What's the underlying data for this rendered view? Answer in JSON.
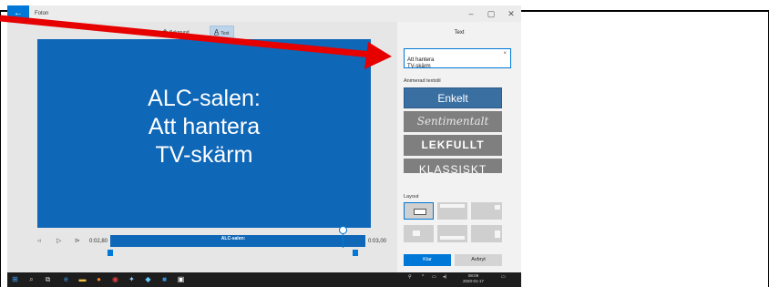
{
  "app": {
    "title": "Foton",
    "back_glyph": "←"
  },
  "window_controls": {
    "minimize": "–",
    "maximize": "▢",
    "close": "✕"
  },
  "toolbar": {
    "background_label": "Bakgrund",
    "text_label": "Text"
  },
  "preview": {
    "title_text": "ALC-salen:\nAtt hantera\nTV-skärm",
    "bg_color": "#0f67b8"
  },
  "playback": {
    "start_time": "0:02,80",
    "end_time": "0:03,00",
    "clip_label": "ALC-salen:"
  },
  "panel": {
    "heading": "Text",
    "input_value": "Att hantera\nTV-skärm",
    "clear_glyph": "×",
    "animated_style_label": "Animerad textstil",
    "styles": [
      "Enkelt",
      "Sentimentalt",
      "LEKFULLT",
      "KLASSISKT"
    ],
    "layout_label": "Layout",
    "ok_button": "Klar",
    "cancel_button": "Avbryt"
  },
  "taskbar": {
    "clock_time": "08:09",
    "clock_date": "2020-01-17"
  },
  "colors": {
    "accent": "#0078d7",
    "annotation_arrow": "#e60000"
  }
}
